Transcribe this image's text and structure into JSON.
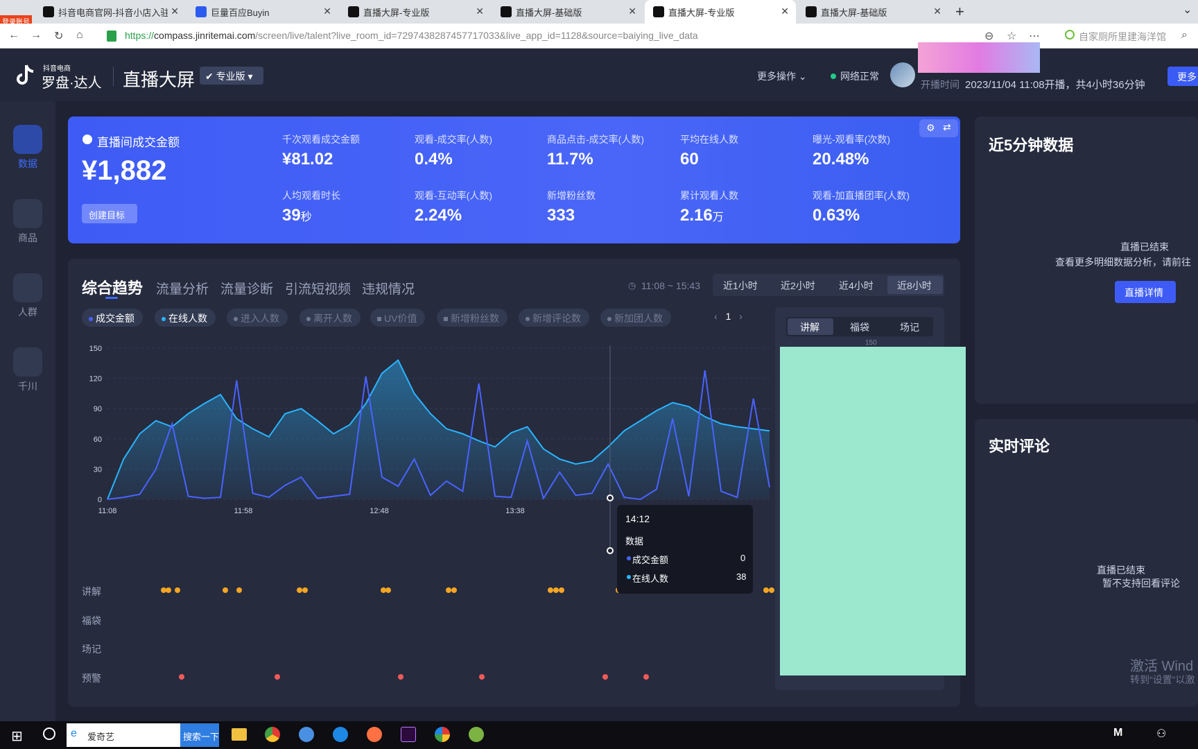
{
  "browser": {
    "badge": "登录账号",
    "tabs": [
      {
        "label": "抖音电商官网-抖音小店入驻-分"
      },
      {
        "label": "巨量百应Buyin"
      },
      {
        "label": "直播大屏-专业版"
      },
      {
        "label": "直播大屏-基础版"
      },
      {
        "label": "直播大屏-专业版",
        "active": true
      },
      {
        "label": "直播大屏-基础版"
      }
    ],
    "url_prefix": "https://",
    "url_host": "compass.jinritemai.com",
    "url_path": "/screen/live/talent?live_room_id=7297438287457717033&live_app_id=1128&source=baiying_live_data",
    "search_text": "自家厕所里建海洋馆"
  },
  "header": {
    "brand_small": "抖音电商",
    "brand": "罗盘·达人",
    "title": "直播大屏",
    "edition": "专业版",
    "more_ops": "更多操作",
    "network": "网络正常",
    "start_label": "开播时间",
    "start_value": "2023/11/04 11:08开播，共4小时36分钟",
    "more_btn": "更多"
  },
  "nav": [
    {
      "label": "数据",
      "active": true
    },
    {
      "label": "商品"
    },
    {
      "label": "人群"
    },
    {
      "label": "千川"
    }
  ],
  "kpi": {
    "main_label": "直播间成交金额",
    "main_value": "¥1,882",
    "target_btn": "创建目标",
    "metrics": [
      {
        "label": "千次观看成交金额",
        "value": "¥81.02"
      },
      {
        "label": "观看-成交率(人数)",
        "value": "0.4%"
      },
      {
        "label": "商品点击-成交率(人数)",
        "value": "11.7%"
      },
      {
        "label": "平均在线人数",
        "value": "60"
      },
      {
        "label": "曝光-观看率(次数)",
        "value": "20.48%"
      },
      {
        "label": "人均观看时长",
        "value": "39",
        "unit": "秒"
      },
      {
        "label": "观看-互动率(人数)",
        "value": "2.24%"
      },
      {
        "label": "新增粉丝数",
        "value": "333"
      },
      {
        "label": "累计观看人数",
        "value": "2.16",
        "unit": "万"
      },
      {
        "label": "观看-加直播团率(人数)",
        "value": "0.63%"
      }
    ]
  },
  "trend": {
    "tabs": [
      "综合趋势",
      "流量分析",
      "流量诊断",
      "引流短视频",
      "违规情况"
    ],
    "time_range": "11:08 ~ 15:43",
    "ranges": [
      "近1小时",
      "近2小时",
      "近4小时",
      "近8小时"
    ],
    "chips": [
      {
        "label": "成交金额",
        "color": "#4a63ff",
        "on": true
      },
      {
        "label": "在线人数",
        "color": "#2ab5ff",
        "on": true
      },
      {
        "label": "进入人数",
        "on": false
      },
      {
        "label": "离开人数",
        "on": false
      },
      {
        "label": "UV价值",
        "on": false
      },
      {
        "label": "新增粉丝数",
        "on": false
      },
      {
        "label": "新增评论数",
        "on": false
      },
      {
        "label": "新加团人数",
        "on": false
      }
    ],
    "page": "1",
    "sub_tabs": [
      "讲解",
      "福袋",
      "场记"
    ],
    "sub_axis_top": "150",
    "row_labels": [
      "讲解",
      "福袋",
      "场记",
      "预警"
    ],
    "tooltip": {
      "time": "14:12",
      "title": "数据",
      "rows": [
        {
          "name": "成交金额",
          "value": "0"
        },
        {
          "name": "在线人数",
          "value": "38"
        }
      ]
    }
  },
  "chart_data": {
    "type": "line",
    "x_ticks": [
      "11:08",
      "11:58",
      "12:48",
      "13:38"
    ],
    "y_ticks": [
      0,
      30,
      60,
      90,
      120,
      150
    ],
    "ylim": [
      0,
      150
    ],
    "series": [
      {
        "name": "在线人数",
        "color": "#2ab5ff",
        "values": [
          0,
          40,
          65,
          78,
          72,
          85,
          95,
          104,
          80,
          70,
          62,
          85,
          90,
          78,
          65,
          74,
          95,
          125,
          138,
          105,
          85,
          70,
          65,
          58,
          52,
          66,
          72,
          50,
          40,
          35,
          38,
          52,
          68,
          78,
          88,
          96,
          92,
          82,
          75,
          72,
          70,
          68
        ]
      },
      {
        "name": "成交金额",
        "color": "#4a63ff",
        "values": [
          0,
          2,
          5,
          30,
          75,
          3,
          1,
          2,
          118,
          6,
          2,
          14,
          22,
          1,
          3,
          5,
          122,
          22,
          13,
          40,
          4,
          18,
          8,
          115,
          3,
          2,
          58,
          1,
          27,
          4,
          6,
          35,
          2,
          0,
          10,
          80,
          3,
          128,
          8,
          2,
          100,
          12
        ]
      }
    ]
  },
  "right": {
    "five_min_title": "近5分钟数据",
    "ended": "直播已结束",
    "ended_hint": "查看更多明细数据分析，请前往",
    "detail_btn": "直播详情",
    "comments_title": "实时评论",
    "comments_ended": "直播已结束",
    "comments_hint": "暂不支持回看评论",
    "watermark_1": "激活 Wind",
    "watermark_2": "转到“设置”以激"
  },
  "taskbar": {
    "search_text": "爱奇艺",
    "search_btn": "搜索一下"
  }
}
